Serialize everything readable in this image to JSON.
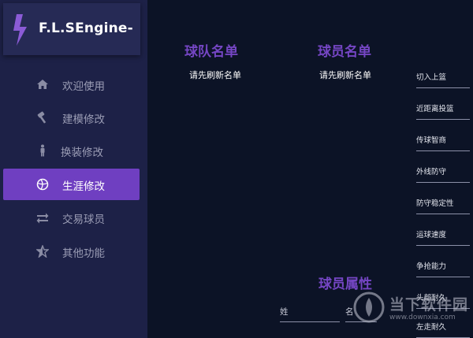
{
  "app": {
    "title": "F.L.SEngine-",
    "accent_color": "#6f3fc1",
    "icon": "lightning-bolt-icon"
  },
  "sidebar": {
    "items": [
      {
        "label": "欢迎使用",
        "icon": "home-icon",
        "active": false
      },
      {
        "label": "建模修改",
        "icon": "hammer-icon",
        "active": false
      },
      {
        "label": "换装修改",
        "icon": "person-icon",
        "active": false
      },
      {
        "label": "生涯修改",
        "icon": "basketball-icon",
        "active": true
      },
      {
        "label": "交易球员",
        "icon": "swap-arrows-icon",
        "active": false
      },
      {
        "label": "其他功能",
        "icon": "star-icon",
        "active": false
      }
    ]
  },
  "main": {
    "team_list": {
      "title": "球队名单",
      "empty_text": "请先刷新名单"
    },
    "player_list": {
      "title": "球员名单",
      "empty_text": "请先刷新名单"
    },
    "player_attrs": {
      "title": "球员属性",
      "surname_label": "姓",
      "name_label": "名"
    },
    "attributes": [
      "切入上篮",
      "近距离投篮",
      "传球智商",
      "外线防守",
      "防守稳定性",
      "运球速度",
      "争抢能力",
      "头部耐久",
      "左走耐久"
    ]
  },
  "watermark": {
    "name": "当下软件园",
    "url": "www.downxia.com"
  }
}
